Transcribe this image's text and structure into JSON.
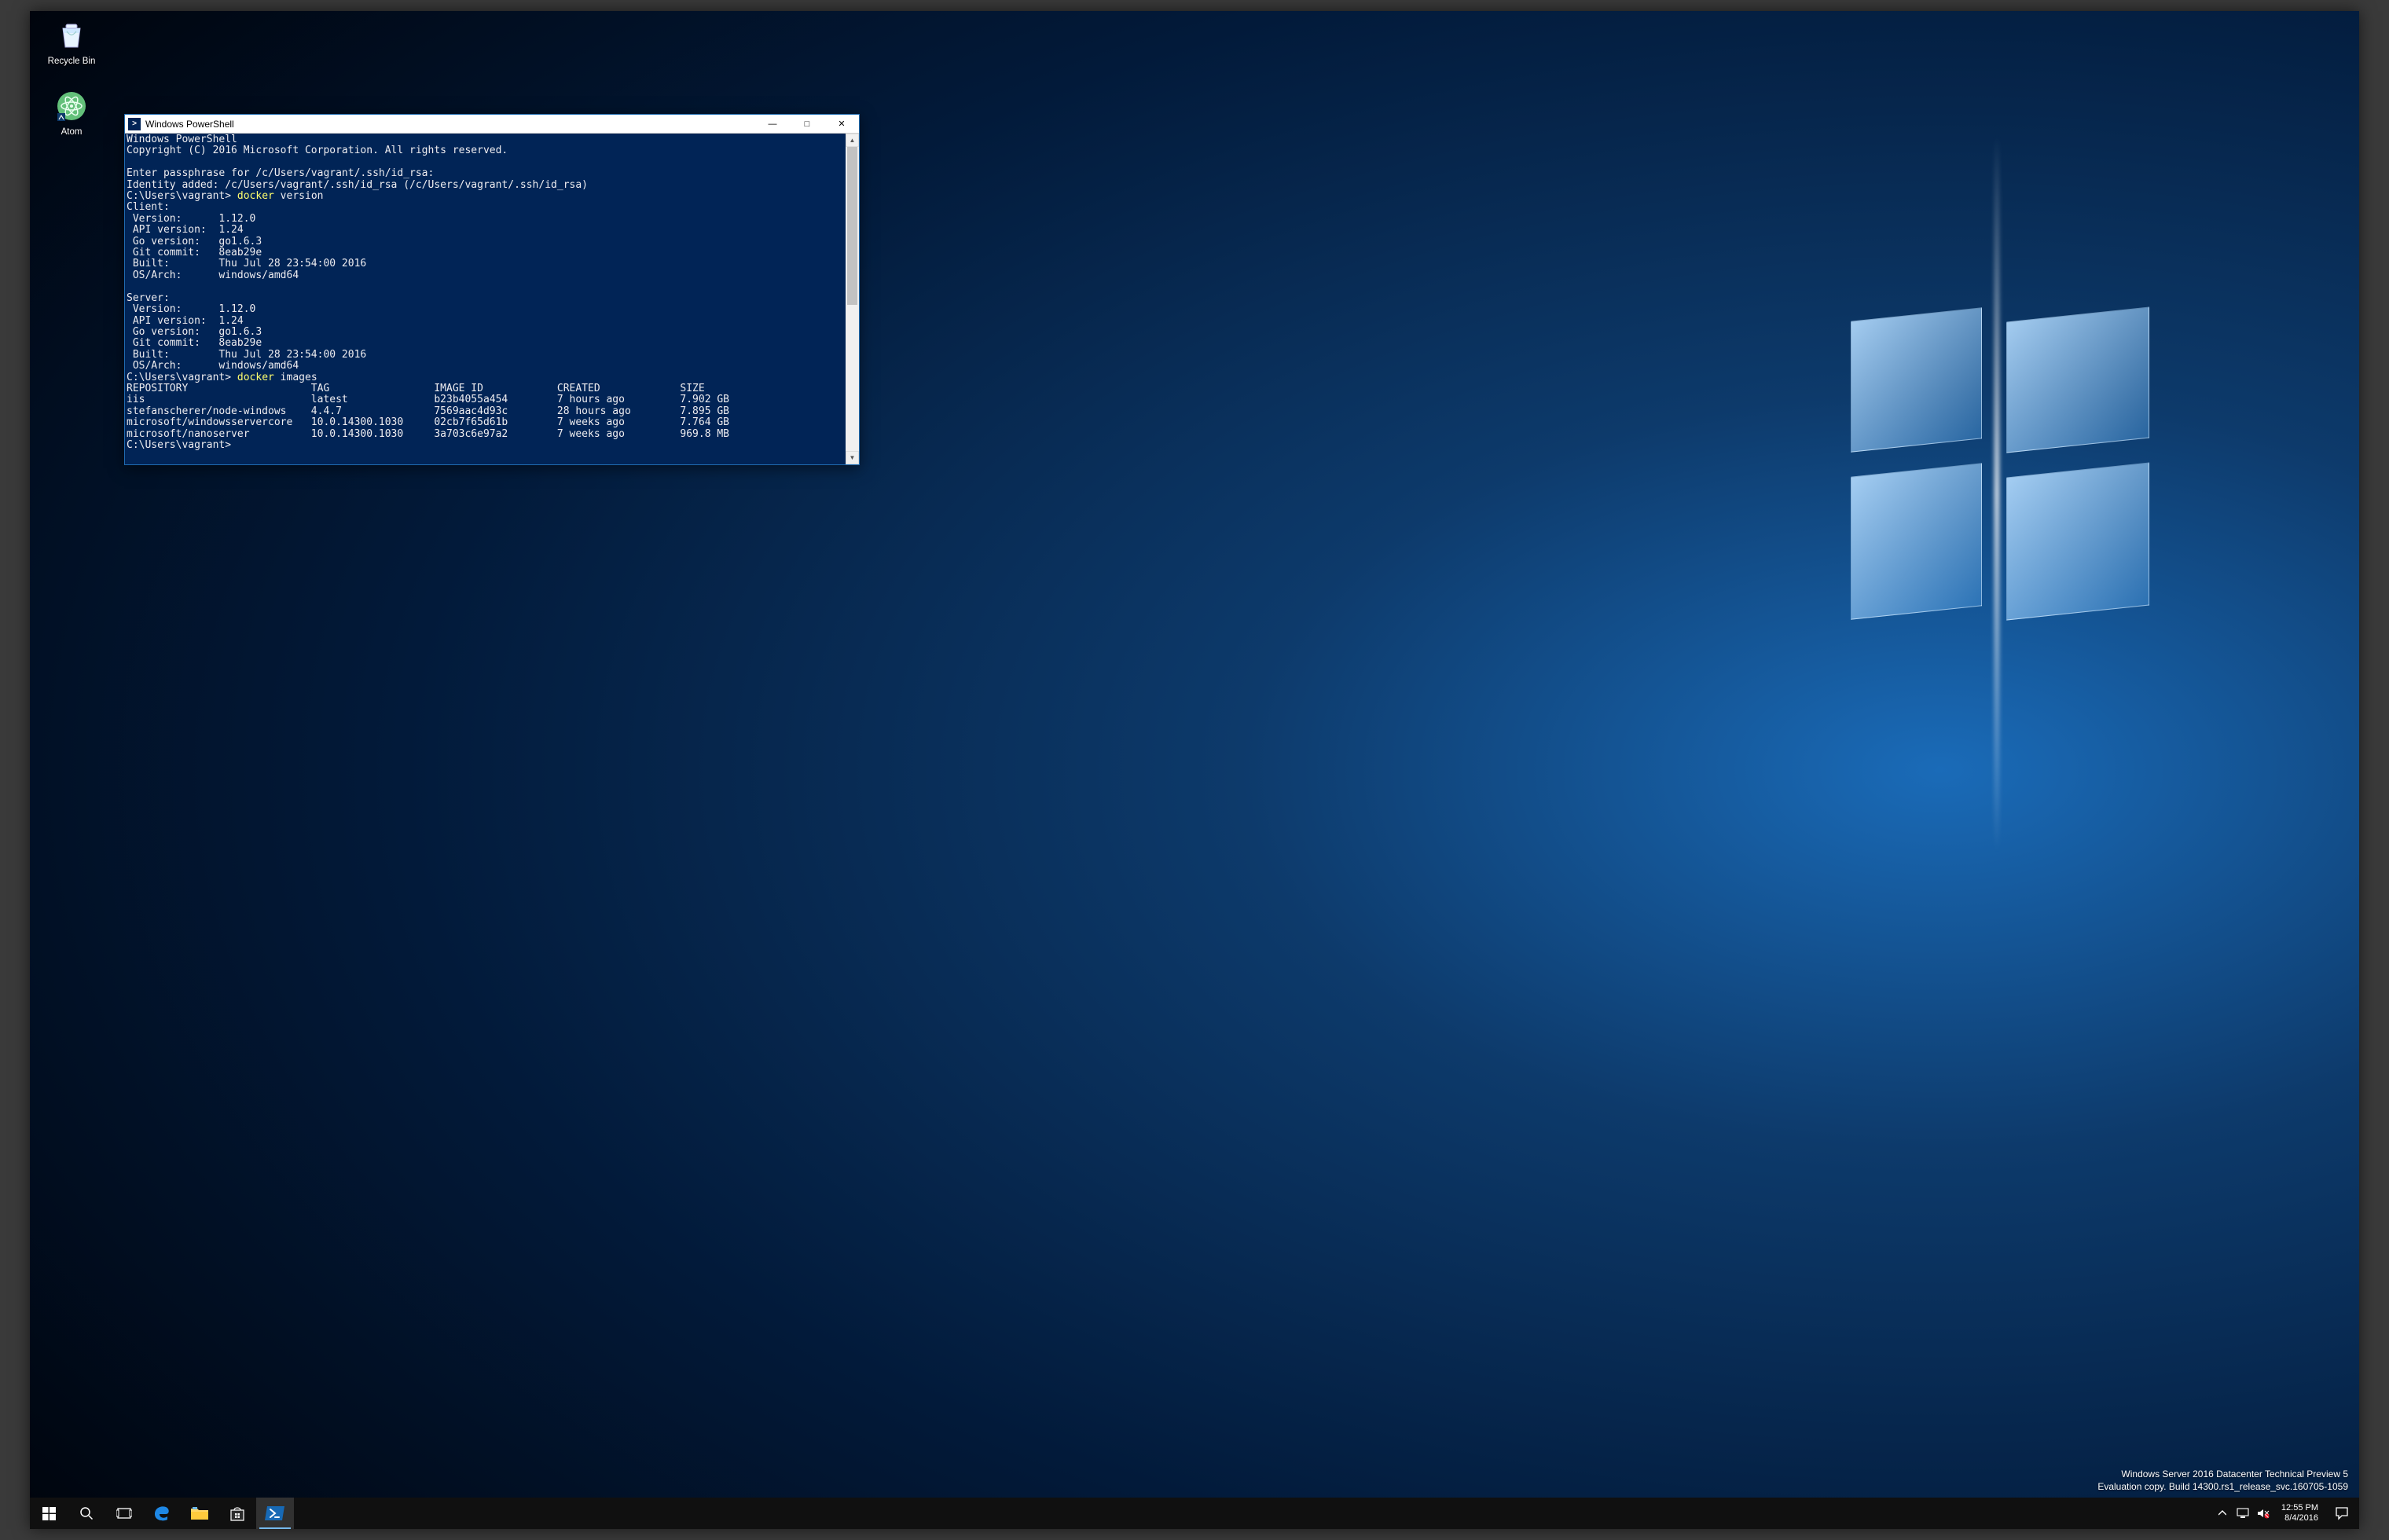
{
  "desktop_icons": {
    "recycle_bin": "Recycle Bin",
    "atom": "Atom"
  },
  "window": {
    "title": "Windows PowerShell"
  },
  "terminal": {
    "header1": "Windows PowerShell",
    "header2": "Copyright (C) 2016 Microsoft Corporation. All rights reserved.",
    "passphrase_prompt": "Enter passphrase for /c/Users/vagrant/.ssh/id_rsa:",
    "identity_added": "Identity added: /c/Users/vagrant/.ssh/id_rsa (/c/Users/vagrant/.ssh/id_rsa)",
    "prompt": "C:\\Users\\vagrant>",
    "cmd1_bin": "docker",
    "cmd1_args": " version",
    "client_label": "Client:",
    "client_version": " Version:      1.12.0",
    "client_api": " API version:  1.24",
    "client_go": " Go version:   go1.6.3",
    "client_git": " Git commit:   8eab29e",
    "client_built": " Built:        Thu Jul 28 23:54:00 2016",
    "client_osarch": " OS/Arch:      windows/amd64",
    "server_label": "Server:",
    "server_version": " Version:      1.12.0",
    "server_api": " API version:  1.24",
    "server_go": " Go version:   go1.6.3",
    "server_git": " Git commit:   8eab29e",
    "server_built": " Built:        Thu Jul 28 23:54:00 2016",
    "server_osarch": " OS/Arch:      windows/amd64",
    "cmd2_bin": "docker",
    "cmd2_args": " images",
    "img_header": "REPOSITORY                    TAG                 IMAGE ID            CREATED             SIZE",
    "img_row1": "iis                           latest              b23b4055a454        7 hours ago         7.902 GB",
    "img_row2": "stefanscherer/node-windows    4.4.7               7569aac4d93c        28 hours ago        7.895 GB",
    "img_row3": "microsoft/windowsservercore   10.0.14300.1030     02cb7f65d61b        7 weeks ago         7.764 GB",
    "img_row4": "microsoft/nanoserver          10.0.14300.1030     3a703c6e97a2        7 weeks ago         969.8 MB",
    "prompt2": "C:\\Users\\vagrant>"
  },
  "watermark": {
    "line1": "Windows Server 2016 Datacenter Technical Preview 5",
    "line2": "Evaluation copy. Build 14300.rs1_release_svc.160705-1059"
  },
  "taskbar": {
    "time": "12:55 PM",
    "date": "8/4/2016"
  }
}
